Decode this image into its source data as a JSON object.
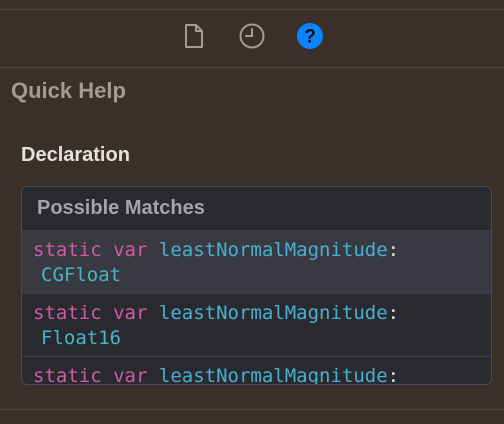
{
  "inspector": {
    "tabs": [
      {
        "name": "file-inspector",
        "icon": "document-icon",
        "active": false
      },
      {
        "name": "history-inspector",
        "icon": "clock-icon",
        "active": false
      },
      {
        "name": "quick-help-inspector",
        "icon": "question-circle-icon",
        "active": true
      }
    ],
    "active_color": "#0a84ff"
  },
  "quick_help": {
    "title": "Quick Help",
    "declaration_title": "Declaration",
    "possible_matches_title": "Possible Matches",
    "matches": [
      {
        "keyword1": "static",
        "keyword2": "var",
        "name": "leastNormalMagnitude",
        "colon": ":",
        "type": "CGFloat"
      },
      {
        "keyword1": "static",
        "keyword2": "var",
        "name": "leastNormalMagnitude",
        "colon": ":",
        "type": "Float16"
      },
      {
        "keyword1": "static",
        "keyword2": "var",
        "name": "leastNormalMagnitude",
        "colon": ":",
        "type": ""
      }
    ]
  },
  "colors": {
    "keyword": "#d15ba6",
    "identifier": "#4ab0cf",
    "type": "#46b5c7"
  }
}
